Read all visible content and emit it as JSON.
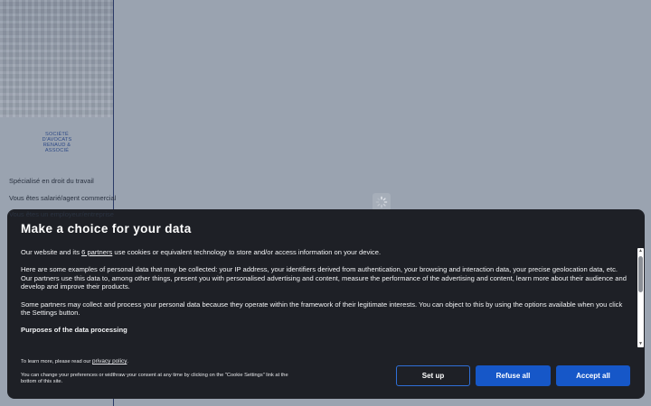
{
  "background": {
    "logo_lines": [
      "SOCIÉTÉ",
      "D'AVOCATS",
      "RENAUD &",
      "ASSOCIÉ"
    ],
    "side_links": [
      "Spécialisé en droit du travail",
      "Vous êtes salarié/agent commercial",
      "Vous êtes un employeur/entreprise"
    ]
  },
  "consent": {
    "title": "Make a choice for your data",
    "intro_before": "Our website and its ",
    "partners_link": "6 partners",
    "intro_after": " use cookies or equivalent technology to store and/or access information on your device.",
    "examples": "Here are some examples of personal data that may be collected: your IP address, your identifiers derived from authentication, your browsing and interaction data, your precise geolocation data, etc.",
    "usage": "Our partners use this data to, among other things, present you with personalised advertising and content, measure the performance of the advertising and content, learn more about their audience and develop and improve their products.",
    "legitimate": "Some partners may collect and process your personal data because they operate within the framework of their legitimate interests. You can object to this by using the options available when you click the Settings button.",
    "purposes_heading": "Purposes of the data processing",
    "learn_more_prefix": "To learn more, please read our ",
    "privacy_link": "privacy policy",
    "learn_more_suffix": ".",
    "change_prefs": "You can change your preferences or widthraw your consent at any time by clicking on the \"Cookie Settings\" link at the bottom of this site.",
    "buttons": {
      "setup": "Set up",
      "refuse": "Refuse all",
      "accept": "Accept all"
    }
  },
  "colors": {
    "modal_bg": "#1e2026",
    "primary_button": "#1657c8",
    "page_overlay": "#9aa3b0"
  }
}
